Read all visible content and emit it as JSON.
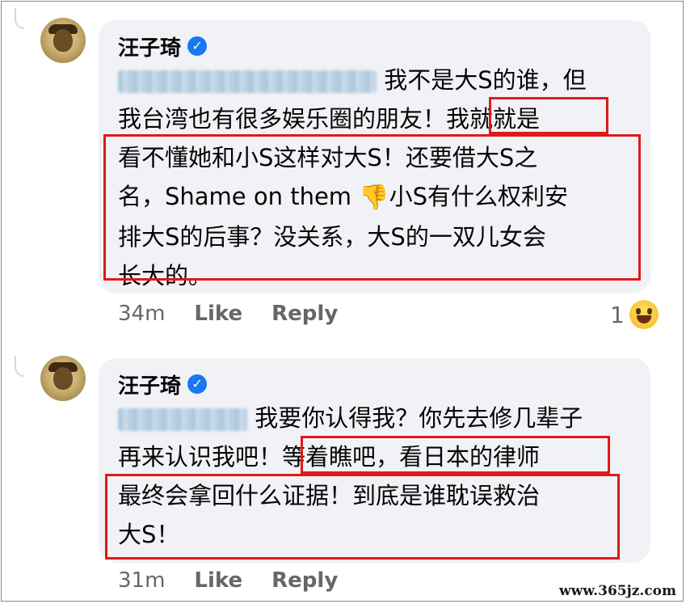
{
  "comments": [
    {
      "author": "汪子琦",
      "verified_icon": "verified-badge-icon",
      "mention_redacted": true,
      "lines": [
        "我不是大S的谁，但",
        "我台湾也有很多娱乐圈的朋友！我就就是",
        "看不懂她和小S这样对大S！还要借大S之",
        "名，Shame on them",
        "小S有什么权利安",
        "排大S的后事？没关系，大S的一双儿女会",
        "长大的。"
      ],
      "emoji": "👎",
      "time": "34m",
      "like_label": "Like",
      "reply_label": "Reply",
      "reaction_count": "1",
      "reaction_icon": "haha-emoji-icon"
    },
    {
      "author": "汪子琦",
      "verified_icon": "verified-badge-icon",
      "mention_redacted": true,
      "lines": [
        "我要你认得我？你先去修几辈子",
        "再来认识我吧！等着瞧吧，看日本的律师",
        "最终会拿回什么证据！到底是谁耽误救治",
        "大S！"
      ],
      "time": "31m",
      "like_label": "Like",
      "reply_label": "Reply"
    }
  ],
  "watermark": "www.365jz.com",
  "colors": {
    "highlight": "#e0191a",
    "bubble": "#f0f2f5",
    "verified": "#1877f2",
    "meta": "#65676b"
  }
}
